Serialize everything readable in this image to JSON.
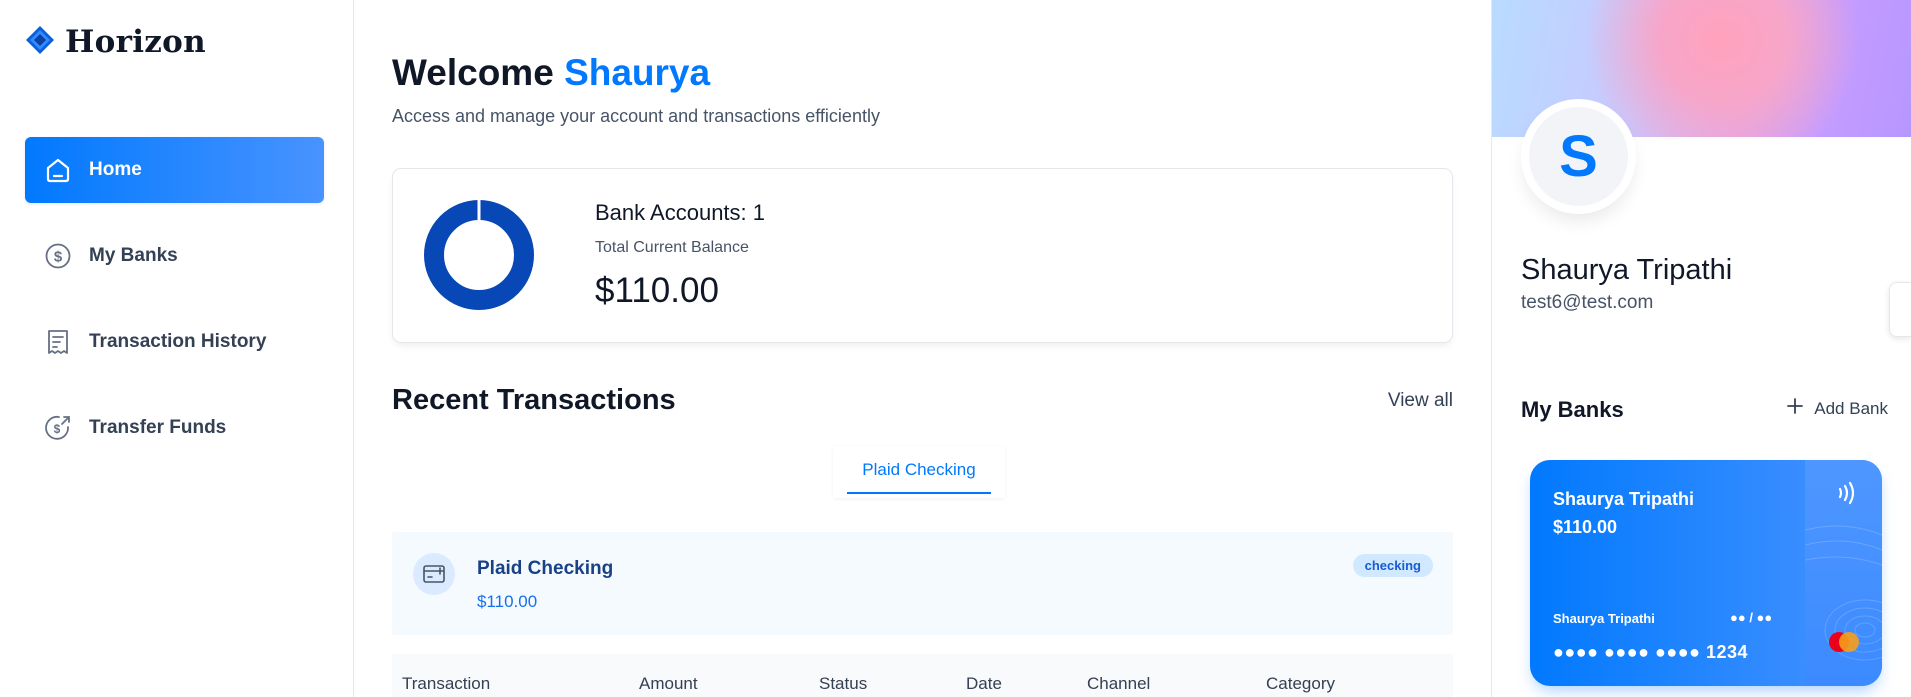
{
  "brand": {
    "name": "Horizon"
  },
  "sidebar": {
    "items": [
      {
        "label": "Home",
        "icon": "home-icon",
        "active": true
      },
      {
        "label": "My Banks",
        "icon": "dollar-circle-icon",
        "active": false
      },
      {
        "label": "Transaction History",
        "icon": "receipt-icon",
        "active": false
      },
      {
        "label": "Transfer Funds",
        "icon": "money-send-icon",
        "active": false
      }
    ]
  },
  "header": {
    "welcome_prefix": "Welcome",
    "user_first_name": "Shaurya",
    "subtitle": "Access and manage your account and transactions efficiently"
  },
  "balance": {
    "accounts_label": "Bank Accounts: 1",
    "total_label": "Total Current Balance",
    "total_value": "$110.00"
  },
  "recent": {
    "title": "Recent Transactions",
    "view_all": "View all",
    "tab": "Plaid Checking",
    "bank": {
      "name": "Plaid Checking",
      "amount": "$110.00",
      "badge": "checking"
    },
    "columns": [
      "Transaction",
      "Amount",
      "Status",
      "Date",
      "Channel",
      "Category"
    ]
  },
  "profile": {
    "initial": "S",
    "name": "Shaurya Tripathi",
    "email": "test6@test.com"
  },
  "my_banks": {
    "title": "My Banks",
    "add_label": "Add Bank",
    "card": {
      "name": "Shaurya Tripathi",
      "balance": "$110.00",
      "holder": "Shaurya Tripathi",
      "expiry": "●● / ●●",
      "number": "●●●● ●●●● ●●●● 1234"
    }
  },
  "colors": {
    "accent": "#0179fe",
    "donut": "#0747b6",
    "badge_bg": "#d1e9ff",
    "badge_text": "#175cd3"
  }
}
